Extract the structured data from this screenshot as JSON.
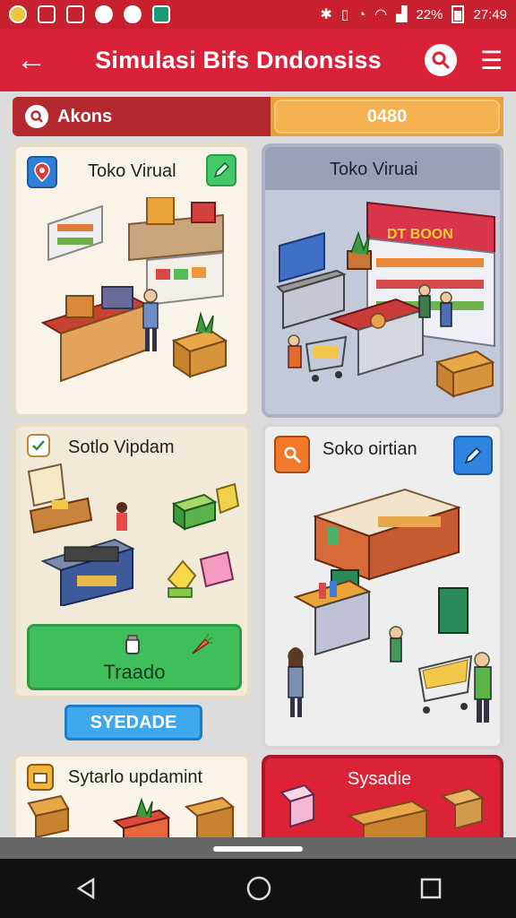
{
  "status_bar": {
    "time": "27:49",
    "battery_text": "22%"
  },
  "app_bar": {
    "title": "Simulasi Bifs Dndonsiss"
  },
  "filter": {
    "left_label": "Akons",
    "right_value": "0480"
  },
  "cards": [
    {
      "title": "Toko Virual"
    },
    {
      "title": "Toko Viruai",
      "sign": "DT BOON"
    },
    {
      "title": "Sotlo Vipdam"
    },
    {
      "title": "Soko oirtian"
    },
    {
      "title": "Sytarlo updamint"
    },
    {
      "title": "Sysadie"
    }
  ],
  "buttons": {
    "green_label": "Traado",
    "blue_label": "SYEDADE"
  },
  "colors": {
    "primary_red": "#d9213a",
    "accent_orange": "#ec9f3f",
    "green": "#3fbf5c",
    "blue": "#3ea8ef"
  }
}
